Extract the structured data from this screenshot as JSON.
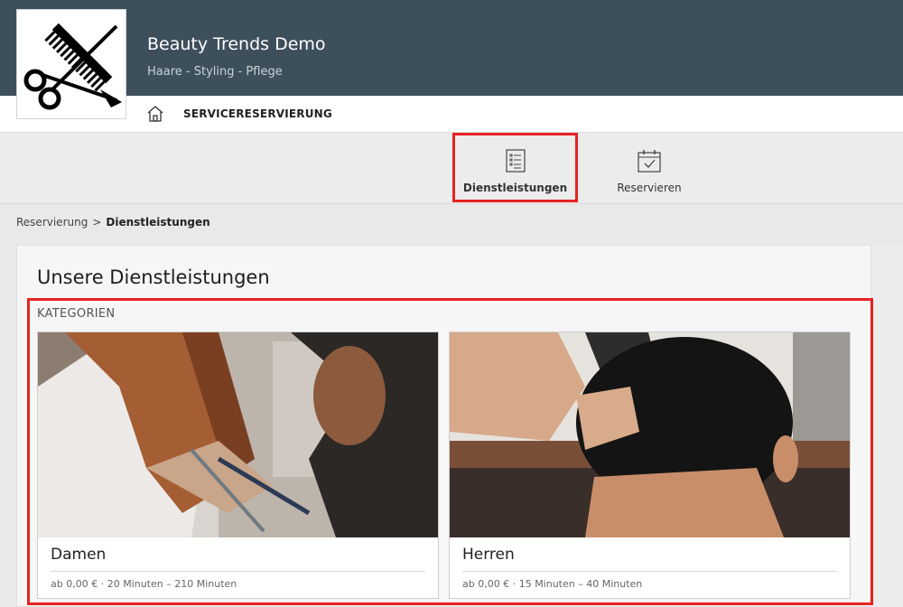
{
  "header": {
    "logo_icon": "scissors-comb-icon",
    "title": "Beauty Trends Demo",
    "subtitle": "Haare - Styling - Pflege"
  },
  "nav": {
    "home_icon": "home-icon",
    "label": "SERVICERESERVIERUNG"
  },
  "steps": [
    {
      "label": "Dienstleistungen",
      "icon": "list-icon",
      "active": true
    },
    {
      "label": "Reservieren",
      "icon": "calendar-check-icon",
      "active": false
    }
  ],
  "breadcrumb": {
    "items": [
      "Reservierung",
      "Dienstleistungen"
    ],
    "separator": ">"
  },
  "main": {
    "title": "Unsere Dienstleistungen",
    "categories_label": "KATEGORIEN",
    "categories": [
      {
        "name": "Damen",
        "meta": "ab 0,00 € · 20 Minuten – 210 Minuten"
      },
      {
        "name": "Herren",
        "meta": "ab 0,00 € · 15 Minuten – 40 Minuten"
      }
    ]
  },
  "colors": {
    "header_bg": "#3e4f5c",
    "highlight": "#e52321",
    "page_bg": "#e9e9e9"
  }
}
